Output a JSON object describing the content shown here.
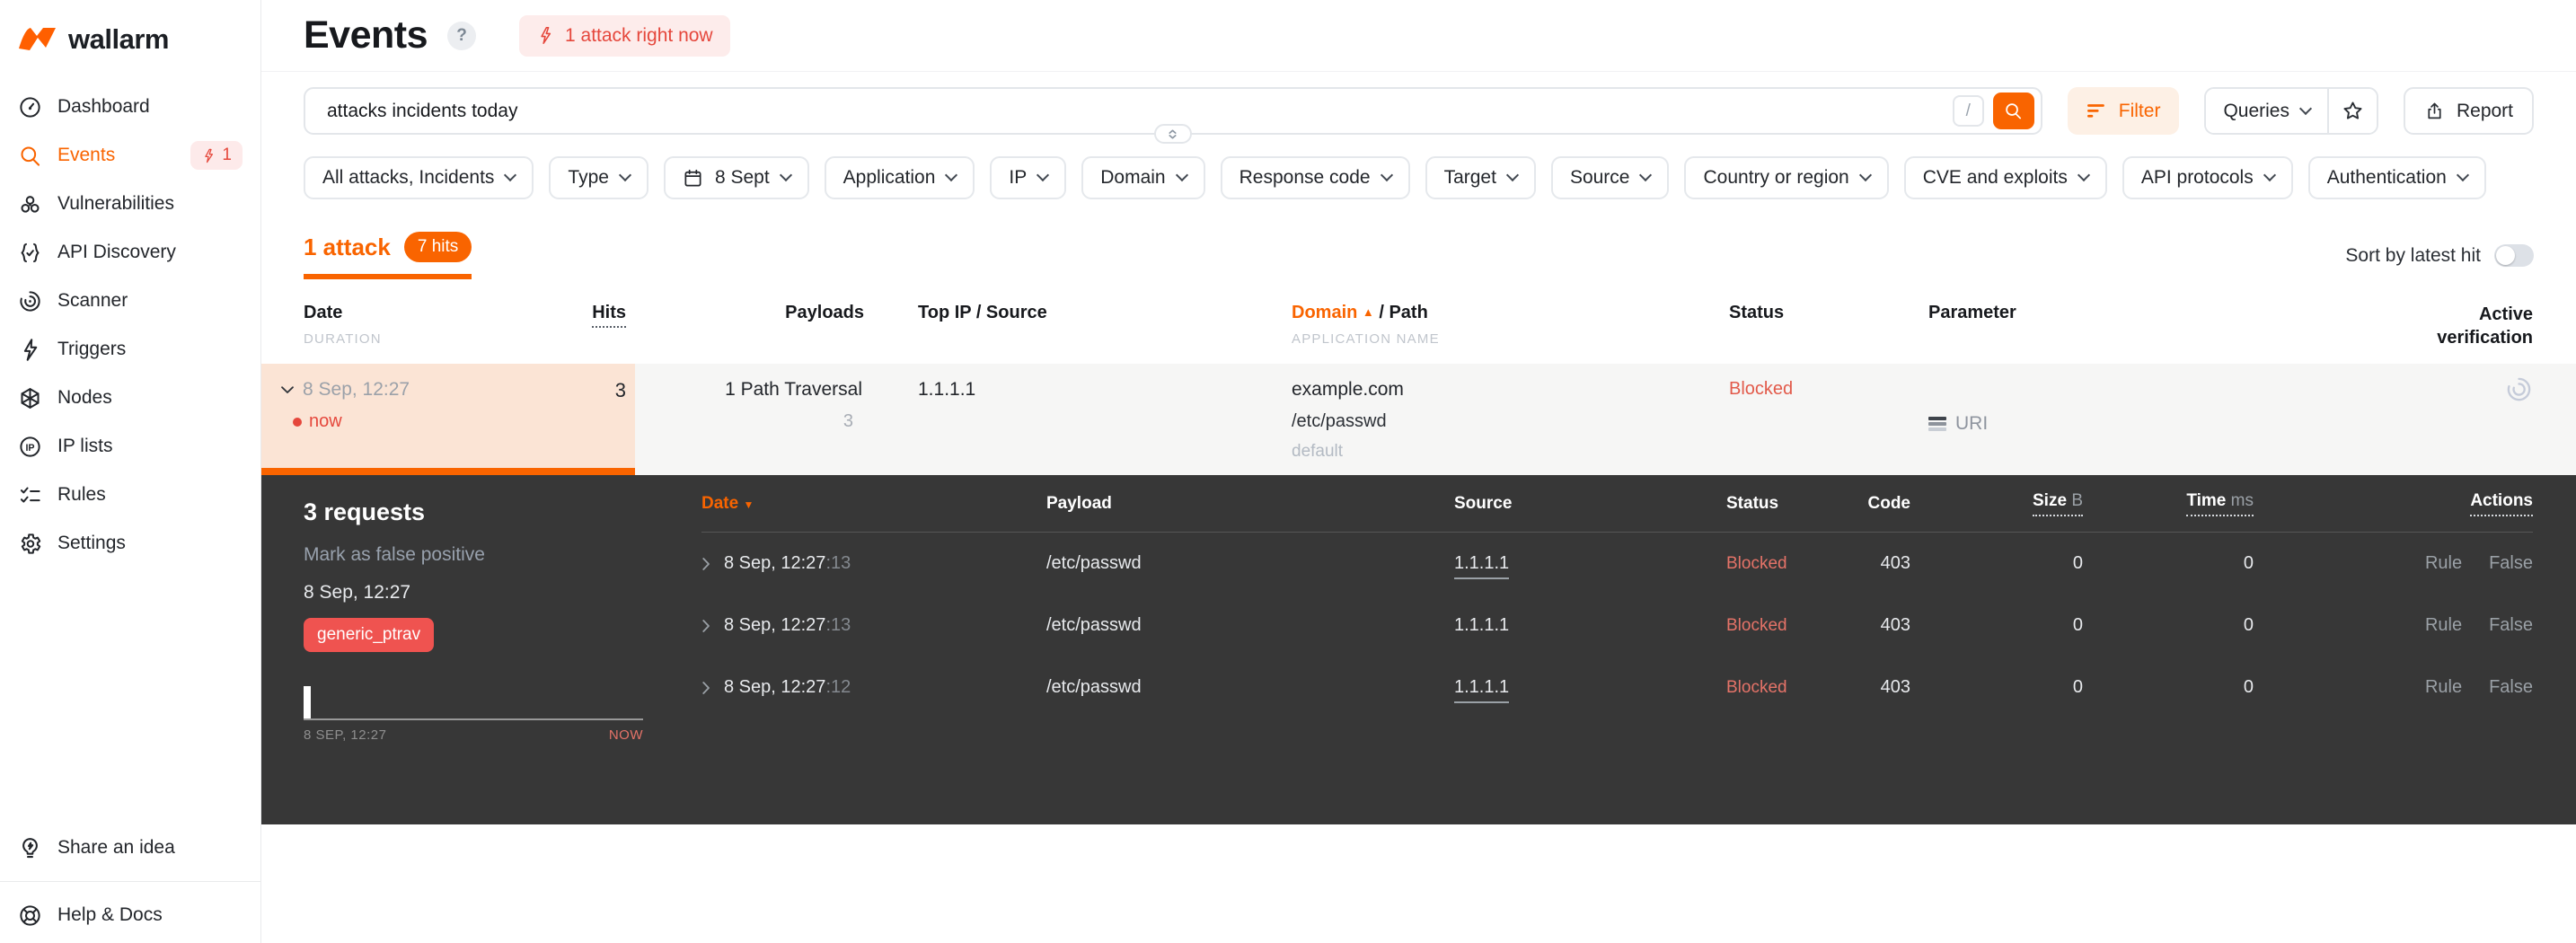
{
  "brand": {
    "name": "wallarm"
  },
  "sidebar": {
    "items": [
      {
        "label": "Dashboard"
      },
      {
        "label": "Events",
        "badge": "1"
      },
      {
        "label": "Vulnerabilities"
      },
      {
        "label": "API Discovery"
      },
      {
        "label": "Scanner"
      },
      {
        "label": "Triggers"
      },
      {
        "label": "Nodes"
      },
      {
        "label": "IP lists"
      },
      {
        "label": "Rules"
      },
      {
        "label": "Settings"
      }
    ],
    "footer": [
      {
        "label": "Share an idea"
      },
      {
        "label": "Help & Docs"
      }
    ]
  },
  "header": {
    "title": "Events",
    "help": "?",
    "alert": "1 attack right now"
  },
  "search": {
    "value": "attacks incidents today",
    "shortcut_key": "/"
  },
  "toolbar": {
    "filter": "Filter",
    "queries": "Queries",
    "report": "Report"
  },
  "filters": [
    "All attacks, Incidents",
    "Type",
    "8 Sept",
    "Application",
    "IP",
    "Domain",
    "Response code",
    "Target",
    "Source",
    "Country or region",
    "CVE and exploits",
    "API protocols",
    "Authentication"
  ],
  "summary": {
    "attack_tab": "1 attack",
    "hits_badge": "7 hits",
    "sort_toggle": "Sort by latest hit"
  },
  "attacks_table": {
    "headers": {
      "date": "Date",
      "duration": "DURATION",
      "hits": "Hits",
      "payloads": "Payloads",
      "top_ip": "Top IP / Source",
      "domain": "Domain",
      "path": "/ Path",
      "application": "APPLICATION NAME",
      "status": "Status",
      "parameter": "Parameter",
      "verification": "Active verification"
    },
    "row": {
      "date": "8 Sep, 12:27",
      "live": "now",
      "hits": "3",
      "payload": "1 Path Traversal",
      "payload_count": "3",
      "top_ip": "1.1.1.1",
      "domain": "example.com",
      "path": "/etc/passwd",
      "application": "default",
      "status": "Blocked",
      "parameter": "URI"
    }
  },
  "detail": {
    "title": "3 requests",
    "false_positive": "Mark as false positive",
    "time": "8 Sep, 12:27",
    "tag": "generic_ptrav",
    "timeline_start": "8 SEP, 12:27",
    "timeline_end": "NOW",
    "headers": {
      "date": "Date",
      "payload": "Payload",
      "source": "Source",
      "status": "Status",
      "code": "Code",
      "size": "Size",
      "size_unit": "B",
      "time": "Time",
      "time_unit": "ms",
      "actions": "Actions"
    },
    "rows": [
      {
        "date": "8 Sep, 12:27",
        "sec": ":13",
        "payload": "/etc/passwd",
        "source": "1.1.1.1",
        "status": "Blocked",
        "code": "403",
        "size": "0",
        "time": "0",
        "rule": "Rule",
        "flag": "False"
      },
      {
        "date": "8 Sep, 12:27",
        "sec": ":13",
        "payload": "/etc/passwd",
        "source": "1.1.1.1",
        "status": "Blocked",
        "code": "403",
        "size": "0",
        "time": "0",
        "rule": "Rule",
        "flag": "False"
      },
      {
        "date": "8 Sep, 12:27",
        "sec": ":12",
        "payload": "/etc/passwd",
        "source": "1.1.1.1",
        "status": "Blocked",
        "code": "403",
        "size": "0",
        "time": "0",
        "rule": "Rule",
        "flag": "False"
      }
    ]
  },
  "colors": {
    "accent": "#F96400",
    "danger": "#E5473C",
    "blocked_dark": "#E57368",
    "panel_bg": "#373737"
  }
}
